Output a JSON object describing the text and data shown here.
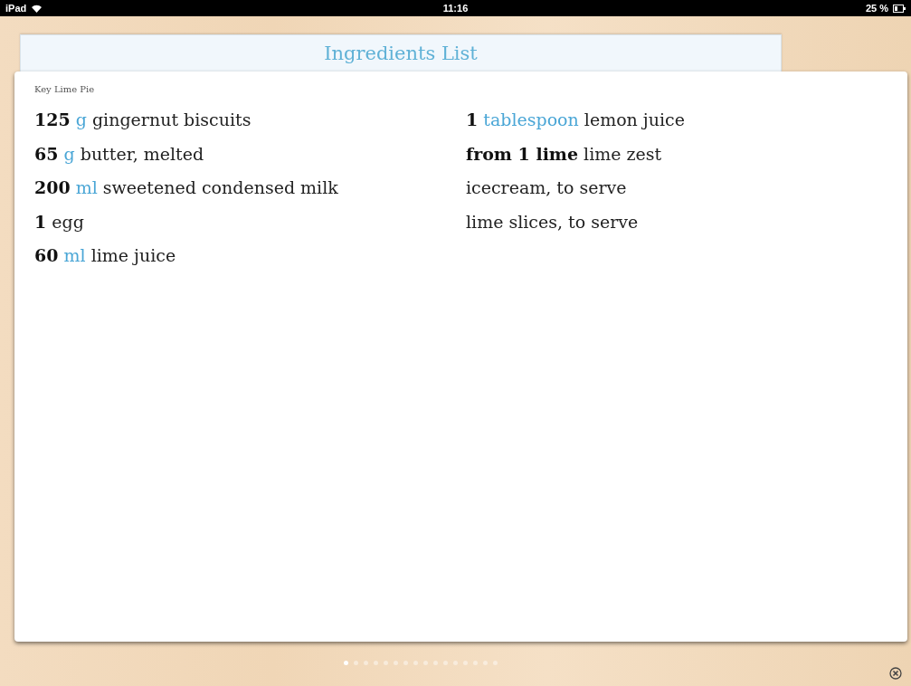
{
  "status_bar": {
    "device": "iPad",
    "time": "11:16",
    "battery": "25 %"
  },
  "header": {
    "title": "Ingredients List"
  },
  "recipe": {
    "name": "Key Lime Pie",
    "columns": [
      [
        {
          "quantity": "125",
          "unit": "g",
          "name": "gingernut biscuits"
        },
        {
          "quantity": "65",
          "unit": "g",
          "name": "butter, melted"
        },
        {
          "quantity": "200",
          "unit": "ml",
          "name": "sweetened condensed milk"
        },
        {
          "quantity": "1",
          "name": "egg"
        },
        {
          "quantity": "60",
          "unit": "ml",
          "name": "lime juice"
        }
      ],
      [
        {
          "quantity": "1",
          "unit": "tablespoon",
          "name": "lemon juice"
        },
        {
          "quantity": "from 1 lime",
          "name": "lime zest"
        },
        {
          "name": "icecream, to serve"
        },
        {
          "name": "lime slices, to serve"
        }
      ]
    ]
  },
  "pages": [
    {
      "selected": true
    },
    {
      "selected": false
    },
    {
      "selected": false
    },
    {
      "selected": false
    },
    {
      "selected": false
    },
    {
      "selected": false
    },
    {
      "selected": false
    },
    {
      "selected": false
    },
    {
      "selected": false
    },
    {
      "selected": false
    },
    {
      "selected": false
    },
    {
      "selected": false
    },
    {
      "selected": false
    },
    {
      "selected": false
    },
    {
      "selected": false
    },
    {
      "selected": false
    }
  ]
}
